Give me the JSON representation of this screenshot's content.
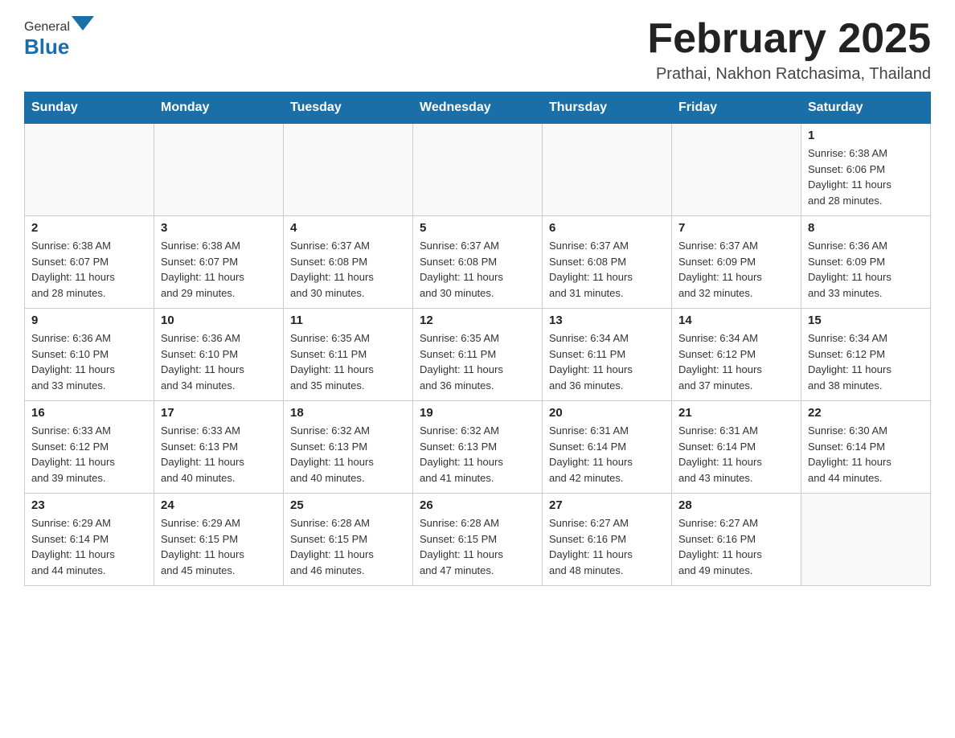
{
  "header": {
    "logo_general": "General",
    "logo_blue": "Blue",
    "month_title": "February 2025",
    "subtitle": "Prathai, Nakhon Ratchasima, Thailand"
  },
  "weekdays": [
    "Sunday",
    "Monday",
    "Tuesday",
    "Wednesday",
    "Thursday",
    "Friday",
    "Saturday"
  ],
  "weeks": [
    {
      "days": [
        {
          "num": "",
          "info": ""
        },
        {
          "num": "",
          "info": ""
        },
        {
          "num": "",
          "info": ""
        },
        {
          "num": "",
          "info": ""
        },
        {
          "num": "",
          "info": ""
        },
        {
          "num": "",
          "info": ""
        },
        {
          "num": "1",
          "info": "Sunrise: 6:38 AM\nSunset: 6:06 PM\nDaylight: 11 hours\nand 28 minutes."
        }
      ]
    },
    {
      "days": [
        {
          "num": "2",
          "info": "Sunrise: 6:38 AM\nSunset: 6:07 PM\nDaylight: 11 hours\nand 28 minutes."
        },
        {
          "num": "3",
          "info": "Sunrise: 6:38 AM\nSunset: 6:07 PM\nDaylight: 11 hours\nand 29 minutes."
        },
        {
          "num": "4",
          "info": "Sunrise: 6:37 AM\nSunset: 6:08 PM\nDaylight: 11 hours\nand 30 minutes."
        },
        {
          "num": "5",
          "info": "Sunrise: 6:37 AM\nSunset: 6:08 PM\nDaylight: 11 hours\nand 30 minutes."
        },
        {
          "num": "6",
          "info": "Sunrise: 6:37 AM\nSunset: 6:08 PM\nDaylight: 11 hours\nand 31 minutes."
        },
        {
          "num": "7",
          "info": "Sunrise: 6:37 AM\nSunset: 6:09 PM\nDaylight: 11 hours\nand 32 minutes."
        },
        {
          "num": "8",
          "info": "Sunrise: 6:36 AM\nSunset: 6:09 PM\nDaylight: 11 hours\nand 33 minutes."
        }
      ]
    },
    {
      "days": [
        {
          "num": "9",
          "info": "Sunrise: 6:36 AM\nSunset: 6:10 PM\nDaylight: 11 hours\nand 33 minutes."
        },
        {
          "num": "10",
          "info": "Sunrise: 6:36 AM\nSunset: 6:10 PM\nDaylight: 11 hours\nand 34 minutes."
        },
        {
          "num": "11",
          "info": "Sunrise: 6:35 AM\nSunset: 6:11 PM\nDaylight: 11 hours\nand 35 minutes."
        },
        {
          "num": "12",
          "info": "Sunrise: 6:35 AM\nSunset: 6:11 PM\nDaylight: 11 hours\nand 36 minutes."
        },
        {
          "num": "13",
          "info": "Sunrise: 6:34 AM\nSunset: 6:11 PM\nDaylight: 11 hours\nand 36 minutes."
        },
        {
          "num": "14",
          "info": "Sunrise: 6:34 AM\nSunset: 6:12 PM\nDaylight: 11 hours\nand 37 minutes."
        },
        {
          "num": "15",
          "info": "Sunrise: 6:34 AM\nSunset: 6:12 PM\nDaylight: 11 hours\nand 38 minutes."
        }
      ]
    },
    {
      "days": [
        {
          "num": "16",
          "info": "Sunrise: 6:33 AM\nSunset: 6:12 PM\nDaylight: 11 hours\nand 39 minutes."
        },
        {
          "num": "17",
          "info": "Sunrise: 6:33 AM\nSunset: 6:13 PM\nDaylight: 11 hours\nand 40 minutes."
        },
        {
          "num": "18",
          "info": "Sunrise: 6:32 AM\nSunset: 6:13 PM\nDaylight: 11 hours\nand 40 minutes."
        },
        {
          "num": "19",
          "info": "Sunrise: 6:32 AM\nSunset: 6:13 PM\nDaylight: 11 hours\nand 41 minutes."
        },
        {
          "num": "20",
          "info": "Sunrise: 6:31 AM\nSunset: 6:14 PM\nDaylight: 11 hours\nand 42 minutes."
        },
        {
          "num": "21",
          "info": "Sunrise: 6:31 AM\nSunset: 6:14 PM\nDaylight: 11 hours\nand 43 minutes."
        },
        {
          "num": "22",
          "info": "Sunrise: 6:30 AM\nSunset: 6:14 PM\nDaylight: 11 hours\nand 44 minutes."
        }
      ]
    },
    {
      "days": [
        {
          "num": "23",
          "info": "Sunrise: 6:29 AM\nSunset: 6:14 PM\nDaylight: 11 hours\nand 44 minutes."
        },
        {
          "num": "24",
          "info": "Sunrise: 6:29 AM\nSunset: 6:15 PM\nDaylight: 11 hours\nand 45 minutes."
        },
        {
          "num": "25",
          "info": "Sunrise: 6:28 AM\nSunset: 6:15 PM\nDaylight: 11 hours\nand 46 minutes."
        },
        {
          "num": "26",
          "info": "Sunrise: 6:28 AM\nSunset: 6:15 PM\nDaylight: 11 hours\nand 47 minutes."
        },
        {
          "num": "27",
          "info": "Sunrise: 6:27 AM\nSunset: 6:16 PM\nDaylight: 11 hours\nand 48 minutes."
        },
        {
          "num": "28",
          "info": "Sunrise: 6:27 AM\nSunset: 6:16 PM\nDaylight: 11 hours\nand 49 minutes."
        },
        {
          "num": "",
          "info": ""
        }
      ]
    }
  ]
}
